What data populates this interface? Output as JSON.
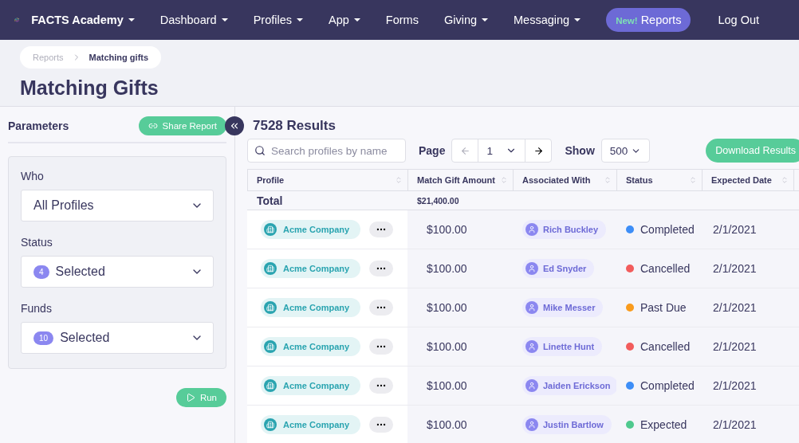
{
  "nav": {
    "brand": "FACTS Academy",
    "items": [
      {
        "label": "Dashboard",
        "has_menu": true,
        "kind": "link"
      },
      {
        "label": "Profiles",
        "has_menu": true,
        "kind": "link"
      },
      {
        "label": "App",
        "has_menu": true,
        "kind": "link"
      },
      {
        "label": "Forms",
        "has_menu": false,
        "kind": "link"
      },
      {
        "label": "Giving",
        "has_menu": true,
        "kind": "link"
      },
      {
        "label": "Messaging",
        "has_menu": true,
        "kind": "link"
      },
      {
        "label": "Reports",
        "badge": "New!",
        "kind": "pill"
      }
    ],
    "logout": "Log Out"
  },
  "breadcrumb": [
    "Reports",
    "Matching gifts"
  ],
  "title": "Matching Gifts",
  "parameters": {
    "heading": "Parameters",
    "share": "Share Report",
    "fields": [
      {
        "label": "Who",
        "value": "All Profiles"
      },
      {
        "label": "Status",
        "count": "4",
        "value": "Selected"
      },
      {
        "label": "Funds",
        "count": "10",
        "value": "Selected"
      }
    ],
    "run": "Run"
  },
  "results": {
    "count": "7528 Results",
    "search_placeholder": "Search profiles by name",
    "page_label": "Page",
    "page": "1",
    "show_label": "Show",
    "show": "500",
    "download": "Download Results"
  },
  "table": {
    "columns": [
      "Profile",
      "Match Gift Amount",
      "Associated With",
      "Status",
      "Expected Date"
    ],
    "total_label": "Total",
    "total_amount": "$21,400.00",
    "rows": [
      {
        "profile": "Acme Company",
        "amount": "$100.00",
        "person": "Rich Buckley",
        "status": "Completed",
        "color": "#3d8ef7",
        "date": "2/1/2021"
      },
      {
        "profile": "Acme Company",
        "amount": "$100.00",
        "person": "Ed Snyder",
        "status": "Cancelled",
        "color": "#f25c5c",
        "date": "2/1/2021"
      },
      {
        "profile": "Acme Company",
        "amount": "$100.00",
        "person": "Mike Messer",
        "status": "Past Due",
        "color": "#f99b1c",
        "date": "2/1/2021"
      },
      {
        "profile": "Acme Company",
        "amount": "$100.00",
        "person": "Linette Hunt",
        "status": "Cancelled",
        "color": "#f25c5c",
        "date": "2/1/2021"
      },
      {
        "profile": "Acme Company",
        "amount": "$100.00",
        "person": "Jaiden Erickson",
        "status": "Completed",
        "color": "#3d8ef7",
        "date": "2/1/2021"
      },
      {
        "profile": "Acme Company",
        "amount": "$100.00",
        "person": "Justin Bartlow",
        "status": "Expected",
        "color": "#4fc98e",
        "date": "2/1/2021"
      }
    ]
  }
}
